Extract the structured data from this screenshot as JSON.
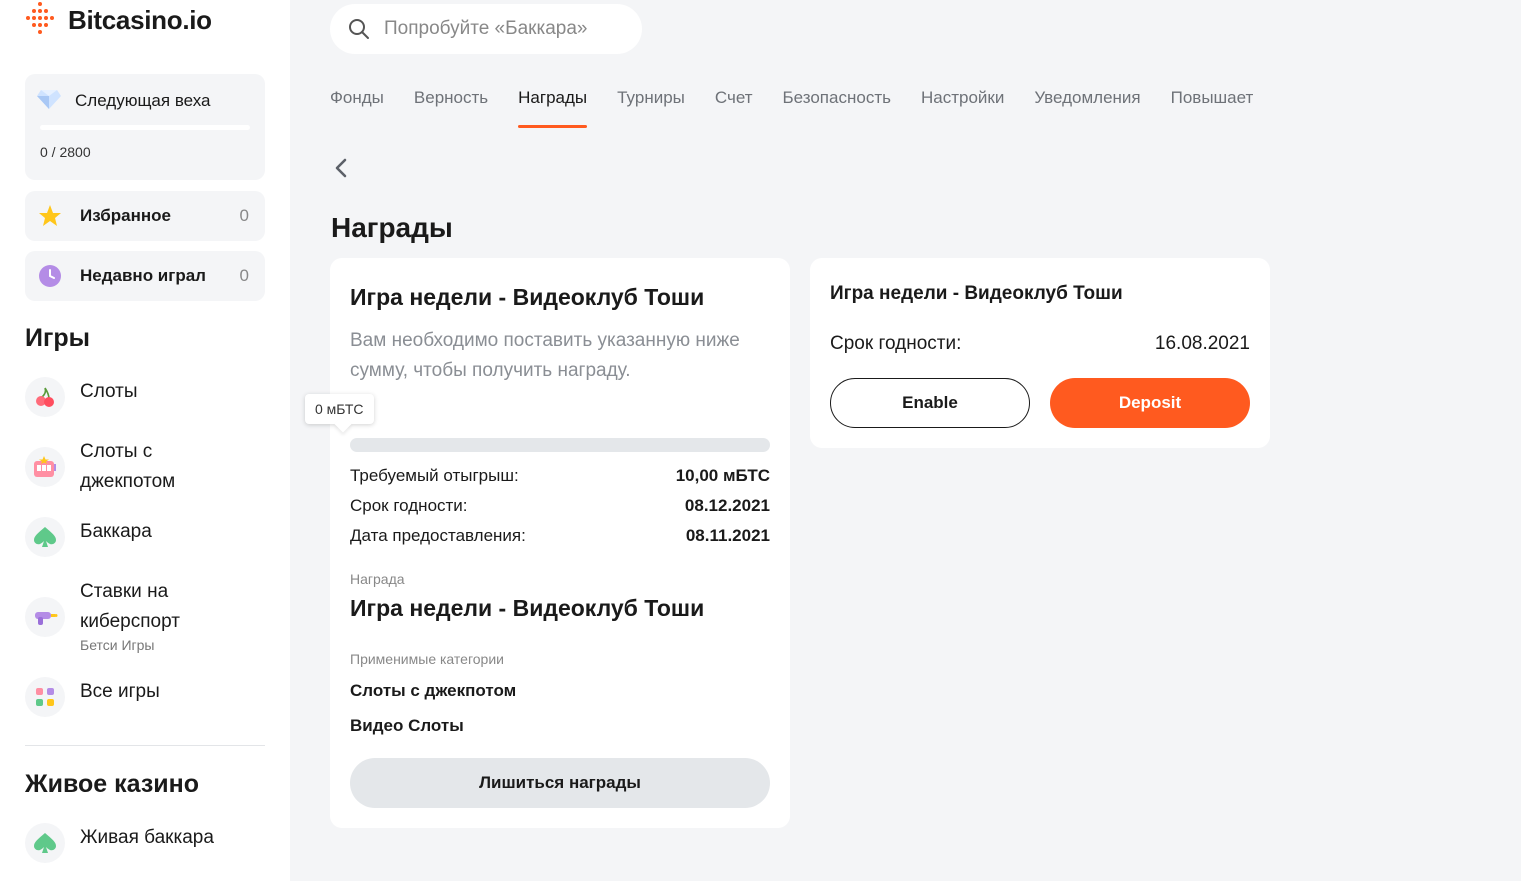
{
  "brand": {
    "name": "Bitcasino.io",
    "accent": "#ff5a1f"
  },
  "sidebar": {
    "milestone": {
      "title": "Следующая веха",
      "count": "0 / 2800",
      "progress": 0,
      "icon": "diamond-icon"
    },
    "favorites": {
      "label": "Избранное",
      "count": "0",
      "icon": "star-icon"
    },
    "recent": {
      "label": "Недавно играл",
      "count": "0",
      "icon": "clock-icon"
    },
    "games_heading": "Игры",
    "games": [
      {
        "label": "Слоты",
        "icon": "cherry-icon"
      },
      {
        "label": "Слоты с джекпотом",
        "icon": "slot-machine-icon"
      },
      {
        "label": "Баккара",
        "icon": "spade-icon"
      },
      {
        "label": "Ставки на киберспорт",
        "sub": "Бетси Игры",
        "icon": "blaster-icon"
      },
      {
        "label": "Все игры",
        "icon": "grid-icon"
      }
    ],
    "live_heading": "Живое казино",
    "live": [
      {
        "label": "Живая баккара",
        "icon": "spade-icon"
      }
    ]
  },
  "search": {
    "placeholder": "Попробуйте «Баккара»"
  },
  "tabs": [
    {
      "label": "Фонды"
    },
    {
      "label": "Верность"
    },
    {
      "label": "Награды",
      "active": true
    },
    {
      "label": "Турниры"
    },
    {
      "label": "Счет"
    },
    {
      "label": "Безопасность"
    },
    {
      "label": "Настройки"
    },
    {
      "label": "Уведомления"
    },
    {
      "label": "Повышает"
    }
  ],
  "page_title": "Награды",
  "card1": {
    "title": "Игра недели - Видеоклуб Тоши",
    "description": "Вам необходимо поставить указанную ниже сумму, чтобы получить награду.",
    "tooltip": "0 мБТС",
    "progress": 0,
    "rows": [
      {
        "key": "Требуемый отыгрыш:",
        "value": "10,00 мБТС"
      },
      {
        "key": "Срок годности:",
        "value": "08.12.2021"
      },
      {
        "key": "Дата предоставления:",
        "value": "08.11.2021"
      }
    ],
    "reward_label": "Награда",
    "reward_name": "Игра недели - Видеоклуб Тоши",
    "categories_label": "Применимые категории",
    "categories": [
      "Слоты с джекпотом",
      "Видео Слоты"
    ],
    "forfeit_button": "Лишиться награды"
  },
  "card2": {
    "title": "Игра недели - Видеоклуб Тоши",
    "expiry_key": "Срок годности:",
    "expiry_value": "16.08.2021",
    "enable_button": "Enable",
    "deposit_button": "Deposit"
  }
}
